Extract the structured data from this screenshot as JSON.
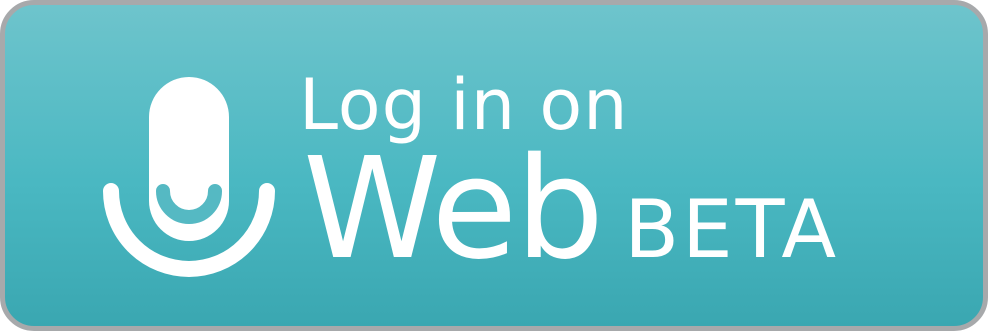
{
  "button": {
    "line1": "Log in on",
    "line2_main": "Web",
    "line2_badge": "BETA",
    "icon": "microphone-icon",
    "colors": {
      "background_top": "#6ec4cc",
      "background_bottom": "#3aa7b1",
      "border": "#a7a9ab",
      "foreground": "#ffffff"
    }
  }
}
